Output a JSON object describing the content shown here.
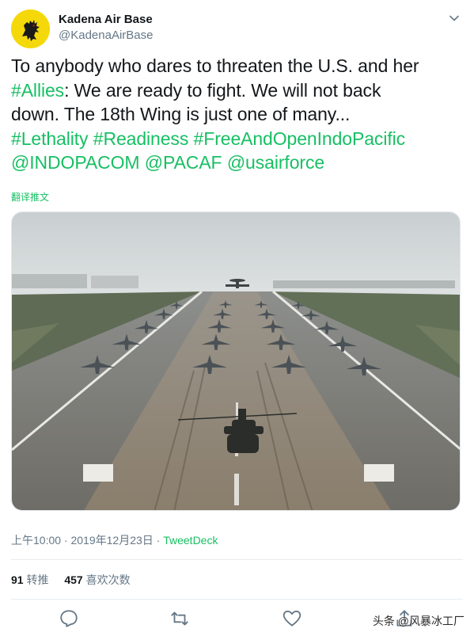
{
  "account": {
    "name": "Kadena Air Base",
    "handle": "@KadenaAirBase"
  },
  "tweet": {
    "line1": "To anybody who dares to threaten the U.S. and her",
    "line2_tag": "#Allies",
    "line2_rest": ": We are ready to fight. We will not back",
    "line3": "down. The 18th Wing is just one of many...",
    "hashtags": [
      "#Lethality",
      "#Readiness",
      "#FreeAndOpenIndoPacific"
    ],
    "mentions": [
      "@INDOPACOM",
      "@PACAF",
      "@usairforce"
    ]
  },
  "translate_label": "翻译推文",
  "meta": {
    "time_date": "上午10:00 · 2019年12月23日 · ",
    "source": "TweetDeck"
  },
  "stats": {
    "retweets_count": "91",
    "retweets_label": "转推",
    "likes_count": "457",
    "likes_label": "喜欢次数"
  },
  "watermark": "头条 @风暴冰工厂",
  "icons": {
    "more": "chevron-down-icon",
    "reply": "reply-icon",
    "retweet": "retweet-icon",
    "like": "heart-icon",
    "share": "share-icon"
  },
  "colors": {
    "accent": "#17bf63",
    "muted": "#657786",
    "text": "#14171a"
  }
}
